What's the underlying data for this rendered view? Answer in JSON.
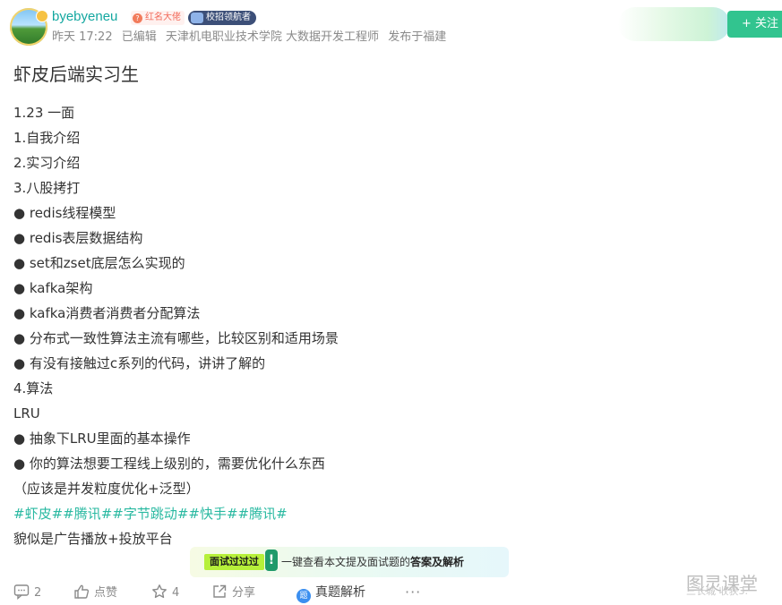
{
  "post": {
    "author": {
      "username": "byebyeneu",
      "tag_red": "红名大佬",
      "tag_campus": "校招领航者"
    },
    "meta": {
      "time": "昨天 17:22",
      "edited": "已编辑",
      "school": "天津机电职业技术学院 大数据开发工程师",
      "location": "发布于福建"
    },
    "follow_label": "+ 关注",
    "title": "虾皮后端实习生",
    "lines": [
      "1.23 一面",
      "1.自我介绍",
      "2.实习介绍",
      "3.八股拷打",
      "● redis线程模型",
      "● redis表层数据结构",
      "● set和zset底层怎么实现的",
      "● kafka架构",
      "● kafka消费者消费者分配算法",
      "● 分布式一致性算法主流有哪些，比较区别和适用场景",
      "● 有没有接触过c系列的代码，讲讲了解的",
      "4.算法",
      "LRU",
      "● 抽象下LRU里面的基本操作",
      "● 你的算法想要工程线上级别的，需要优化什么东西",
      "（应该是并发粒度优化+泛型）"
    ],
    "hashtags": "#虾皮##腾讯##字节跳动##快手##腾讯#",
    "last_line": "貌似是广告播放+投放平台"
  },
  "promo": {
    "badge": "面试过过过",
    "bang": "!",
    "text_prefix": "一键查看本文提及面试题的",
    "text_bold": "答案及解析"
  },
  "footer": {
    "comments": "2",
    "like": "点赞",
    "stars": "4",
    "share": "分享",
    "answer_icon": "题",
    "answer": "真题解析",
    "more": "···"
  },
  "watermark": {
    "title": "图灵课堂",
    "sub": "三长城 收获3."
  },
  "colors": {
    "accent": "#32c48f",
    "username": "#13a7a0",
    "hashtag": "#29b9a1"
  },
  "icons": {
    "comment": "comment-icon",
    "like": "thumbs-up-icon",
    "star": "star-icon",
    "share": "share-icon"
  }
}
